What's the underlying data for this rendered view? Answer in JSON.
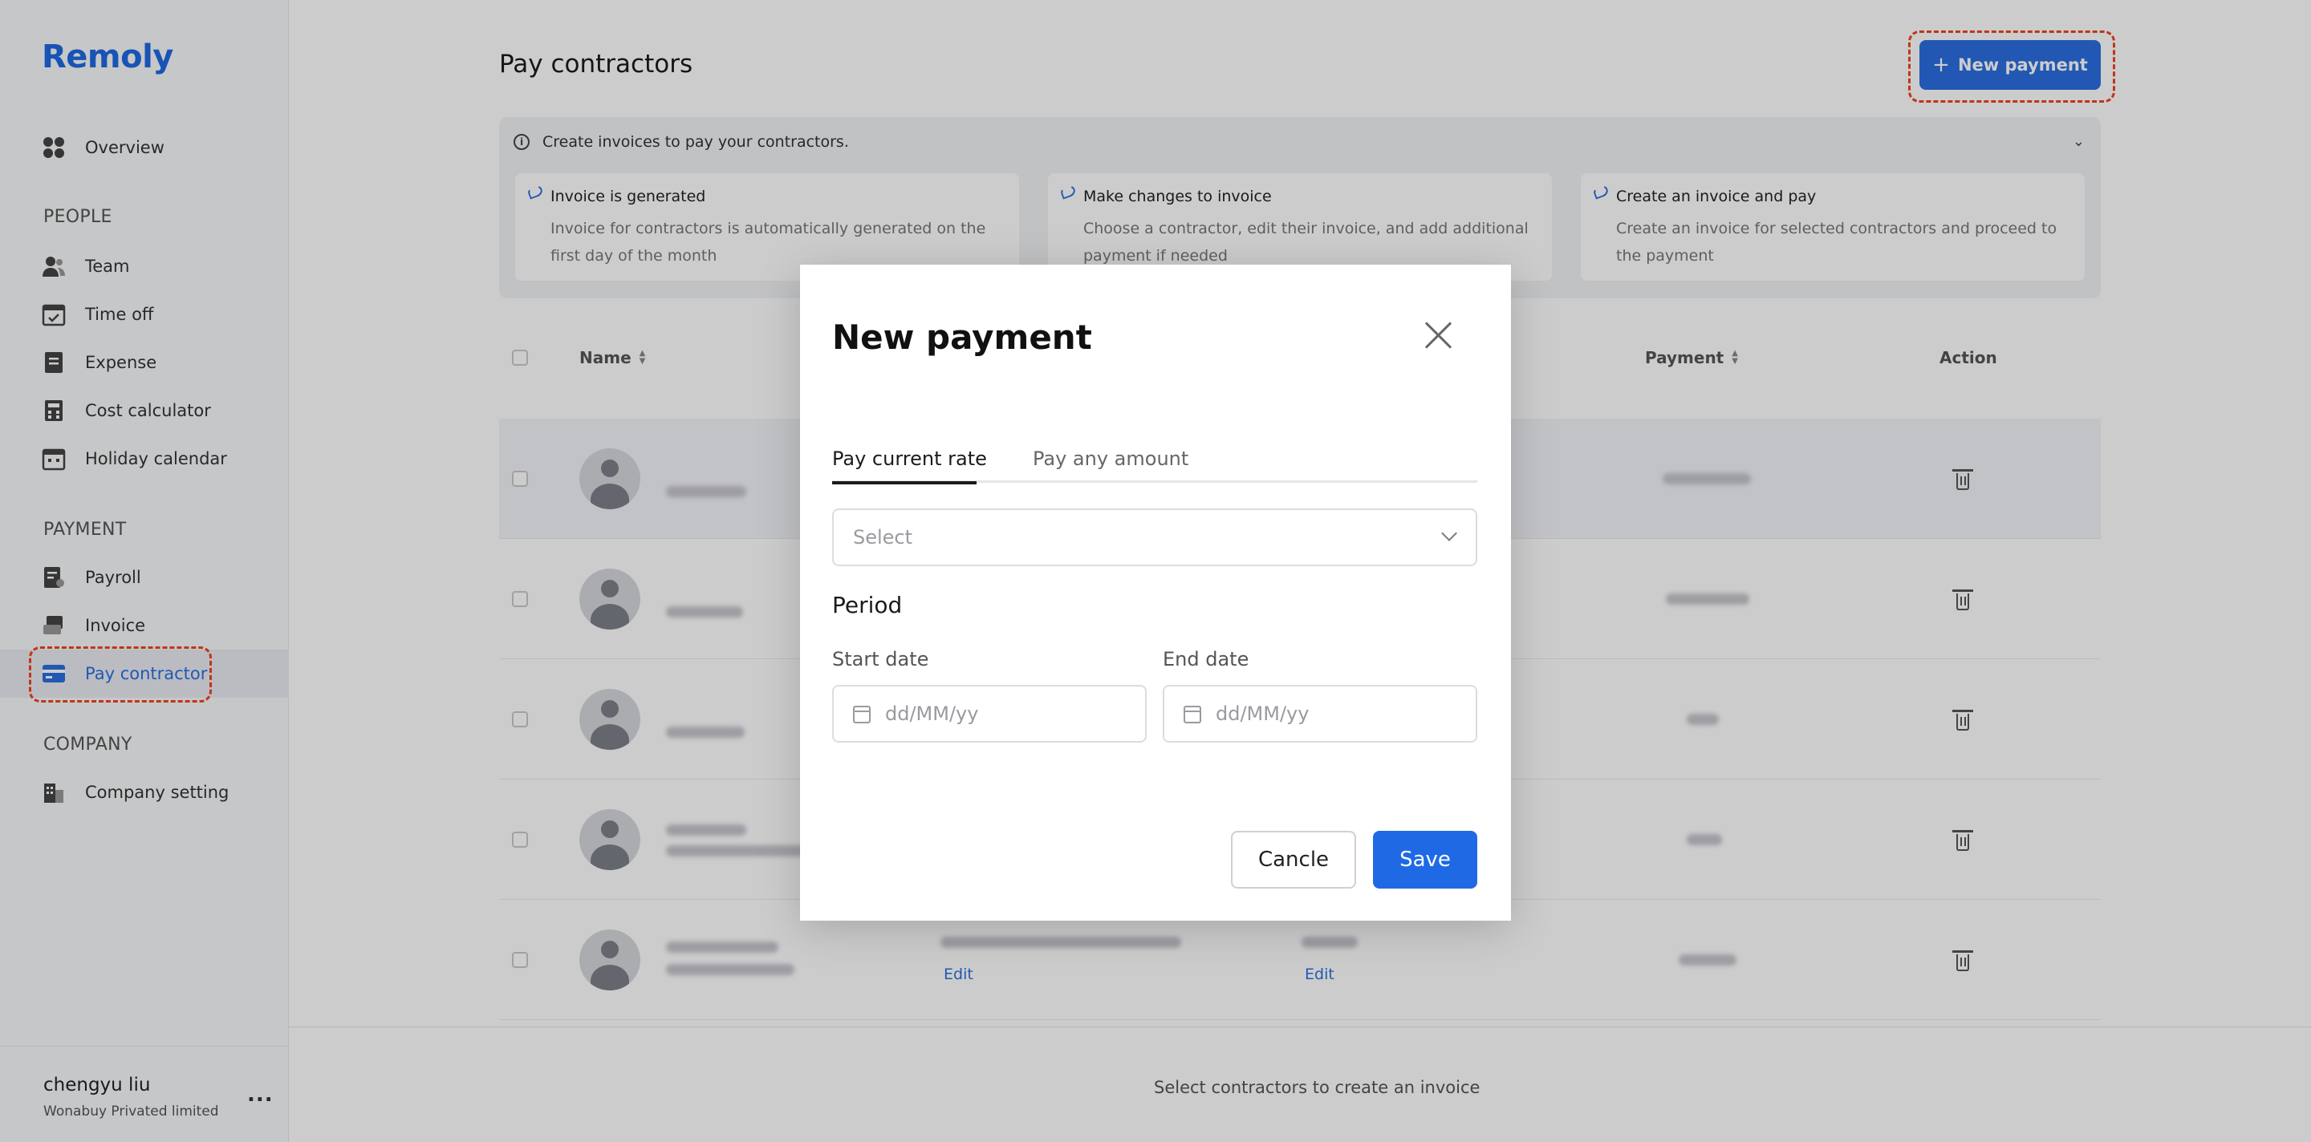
{
  "app": {
    "name": "Remoly"
  },
  "sidebar": {
    "overview": "Overview",
    "sections": {
      "people": "PEOPLE",
      "payment": "PAYMENT",
      "company": "COMPANY"
    },
    "people_items": [
      "Team",
      "Time off",
      "Expense",
      "Cost calculator",
      "Holiday calendar"
    ],
    "payment_items": [
      "Payroll",
      "Invoice",
      "Pay contractor"
    ],
    "company_items": [
      "Company setting"
    ],
    "active_item": "Pay contractor",
    "user": {
      "name": "chengyu liu",
      "org": "Wonabuy Privated limited",
      "menu": "..."
    }
  },
  "header": {
    "title": "Pay contractors",
    "new_payment_label": "New payment",
    "plus": "+"
  },
  "info": {
    "headline": "Create invoices to pay your contractors.",
    "cards": [
      {
        "title": "Invoice is generated",
        "desc": "Invoice for contractors is automatically generated on the first day of the month"
      },
      {
        "title": "Make changes to invoice",
        "desc": "Choose a contractor, edit their invoice, and add additional payment if needed"
      },
      {
        "title": "Create an invoice and pay",
        "desc": "Create an invoice for selected contractors and proceed to the payment"
      }
    ]
  },
  "table": {
    "columns": {
      "name": "Name",
      "payment": "Payment",
      "action": "Action"
    },
    "edit_label": "Edit"
  },
  "footer": {
    "hint": "Select contractors to create an invoice"
  },
  "modal": {
    "title": "New payment",
    "tabs": [
      "Pay current rate",
      "Pay any amount"
    ],
    "active_tab": "Pay current rate",
    "select_placeholder": "Select",
    "period_label": "Period",
    "start_label": "Start date",
    "end_label": "End date",
    "date_placeholder": "dd/MM/yy",
    "cancel_label": "Cancle",
    "save_label": "Save"
  },
  "colors": {
    "accent": "#1f6ae4",
    "highlight": "#f0431f"
  }
}
